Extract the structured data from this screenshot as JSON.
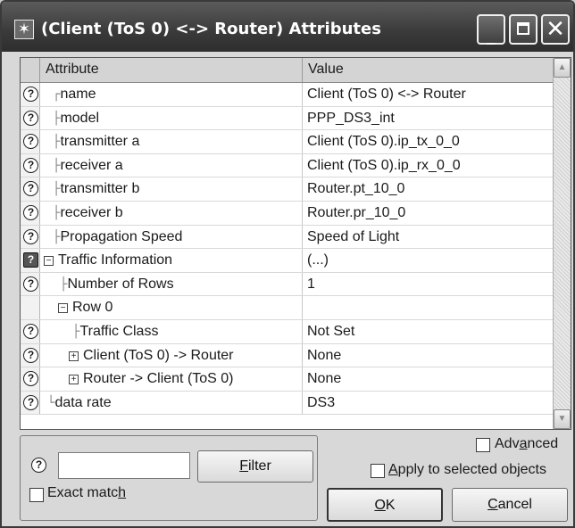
{
  "window": {
    "title": "(Client (ToS 0) <-> Router) Attributes",
    "app_icon": "✶",
    "minimize": "_",
    "close": "✕"
  },
  "table": {
    "headers": [
      "Attribute",
      "Value"
    ],
    "rows": [
      {
        "tree": "┌",
        "expander": "",
        "label": "name",
        "value": "Client (ToS 0) <-> Router"
      },
      {
        "tree": "├",
        "expander": "",
        "label": "model",
        "value": "PPP_DS3_int"
      },
      {
        "tree": "├",
        "expander": "",
        "label": "transmitter a",
        "value": "Client (ToS 0).ip_tx_0_0"
      },
      {
        "tree": "├",
        "expander": "",
        "label": "receiver a",
        "value": "Client (ToS 0).ip_rx_0_0"
      },
      {
        "tree": "├",
        "expander": "",
        "label": "transmitter b",
        "value": "Router.pt_10_0"
      },
      {
        "tree": "├",
        "expander": "",
        "label": "receiver b",
        "value": "Router.pr_10_0"
      },
      {
        "tree": "├",
        "expander": "",
        "label": "Propagation Speed",
        "value": "Speed of Light"
      },
      {
        "tree": "",
        "expander": "⊟",
        "label": "Traffic Information",
        "value": "(...)"
      },
      {
        "tree": "├",
        "expander": "",
        "label": "Number of Rows",
        "value": "1"
      },
      {
        "tree": "",
        "expander": "⊟",
        "label": "Row 0",
        "value": ""
      },
      {
        "tree": "├",
        "expander": "",
        "label": "Traffic Class",
        "value": "Not Set"
      },
      {
        "tree": "",
        "expander": "⊞",
        "label": "Client (ToS 0) -> Router",
        "value": "None"
      },
      {
        "tree": "",
        "expander": "⊞",
        "label": "Router -> Client (ToS 0)",
        "value": "None"
      },
      {
        "tree": "└",
        "expander": "",
        "label": "data rate",
        "value": "DS3"
      }
    ]
  },
  "filter": {
    "value": "",
    "button_pre": "",
    "button_key": "F",
    "button_post": "ilter",
    "exact_match_pre": "Exact matc",
    "exact_match_key": "h",
    "exact_match_checked": false
  },
  "options": {
    "advanced_pre": "Adv",
    "advanced_key": "a",
    "advanced_post": "nced",
    "advanced_checked": false,
    "apply_key": "A",
    "apply_post": "pply to selected objects",
    "apply_checked": false
  },
  "buttons": {
    "ok_key": "O",
    "ok_post": "K",
    "cancel_key": "C",
    "cancel_post": "ancel"
  },
  "colors": {
    "titlebar": "#3a3a3a",
    "dialog_bg": "#d8d8d8",
    "grid_bg": "#ffffff"
  }
}
